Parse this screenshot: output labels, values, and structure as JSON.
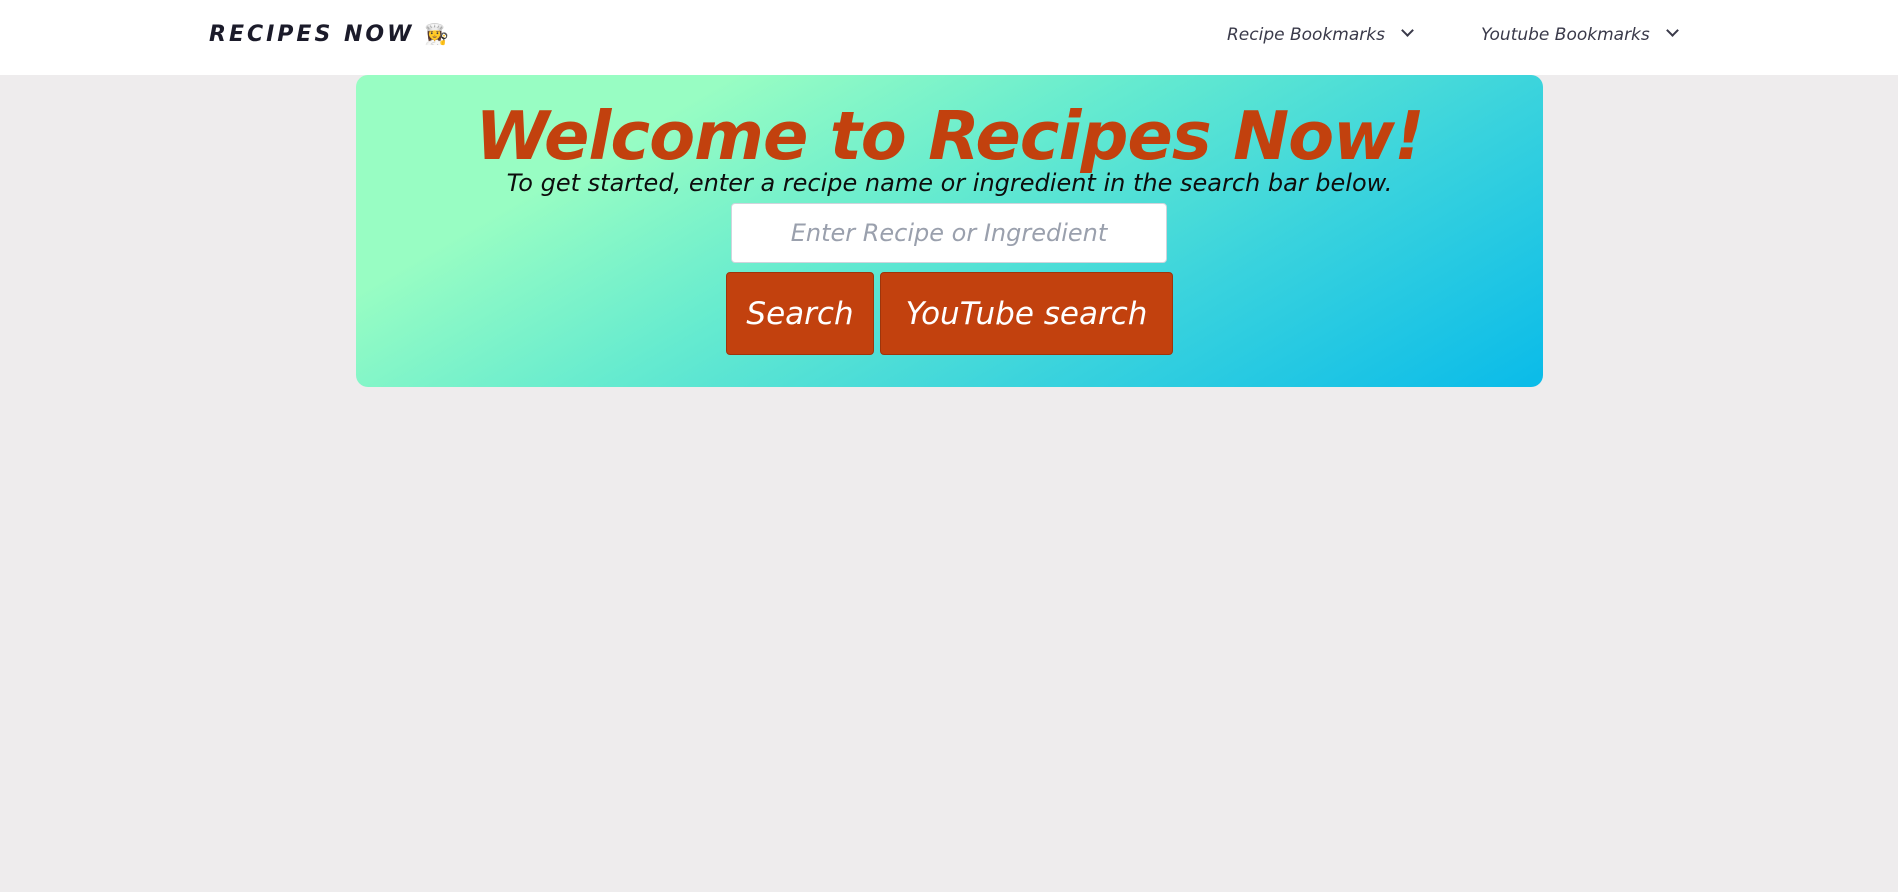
{
  "navbar": {
    "brand": "RECIPES NOW",
    "brand_emoji": "👩‍🍳",
    "menu": [
      {
        "label": "Recipe Bookmarks",
        "icon": "chevron-down-icon"
      },
      {
        "label": "Youtube Bookmarks",
        "icon": "chevron-down-icon"
      }
    ]
  },
  "hero": {
    "title": "Welcome to Recipes Now!",
    "subtitle": "To get started, enter a recipe name or ingredient in the search bar below.",
    "search": {
      "placeholder": "Enter Recipe or Ingredient",
      "value": ""
    },
    "buttons": {
      "search": "Search",
      "youtube_search": "YouTube search"
    }
  },
  "colors": {
    "accent": "#c2410e",
    "gradient_start": "#98fdc3",
    "gradient_end": "#0abbe9",
    "page_background": "#eeeced"
  }
}
